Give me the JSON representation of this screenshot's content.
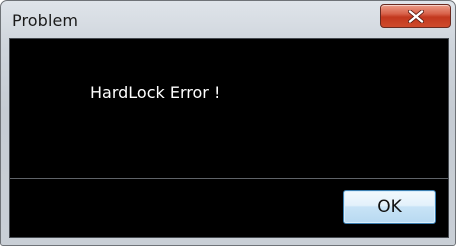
{
  "window": {
    "title": "Problem"
  },
  "dialog": {
    "message": "HardLock Error !",
    "ok_label": "OK"
  },
  "icons": {
    "close": "close-x-icon"
  },
  "colors": {
    "client_background": "#000000",
    "message_text": "#ffffff",
    "close_button": "#c2381e",
    "ok_button_border": "#3c7fb1"
  }
}
